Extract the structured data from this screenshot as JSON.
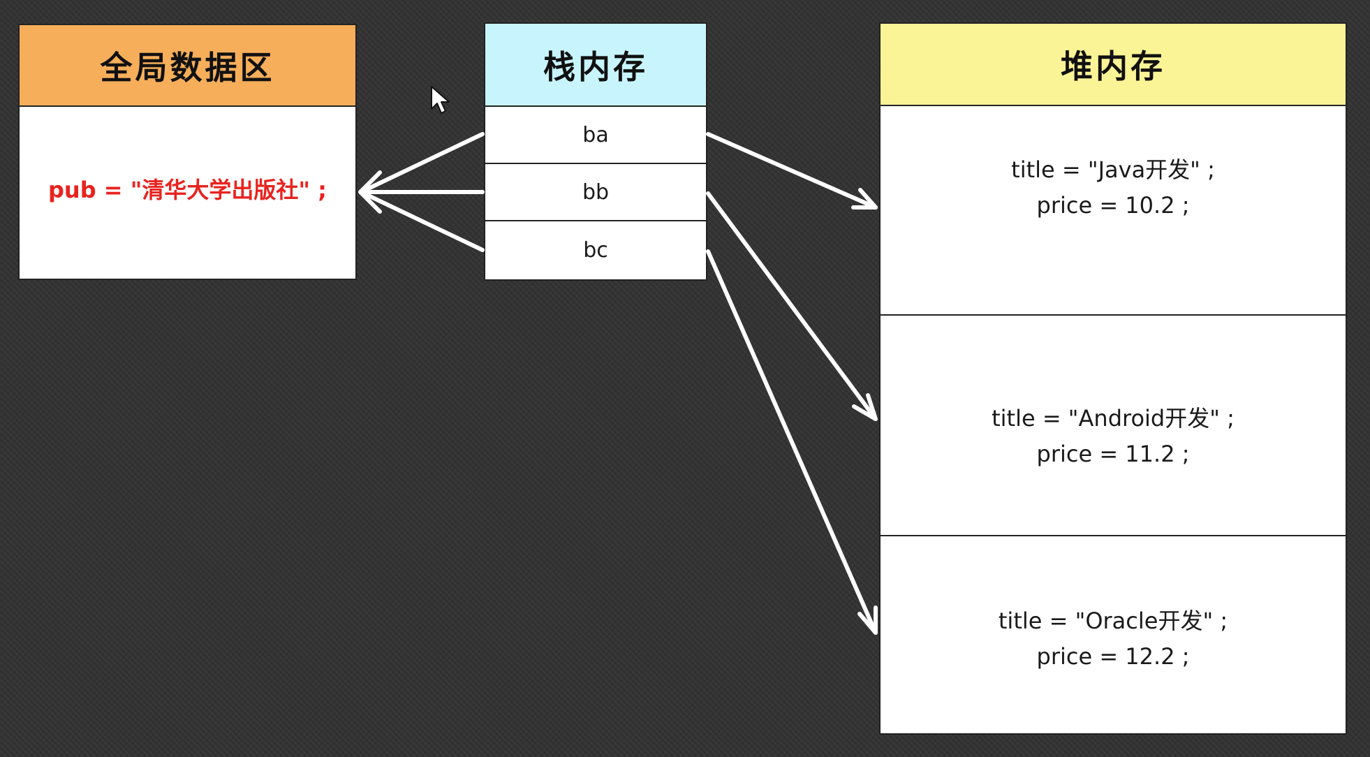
{
  "global_area": {
    "title": "全局数据区",
    "header_color": "#f6ae5b",
    "content": "pub = \"清华大学出版社\" ;",
    "content_color": "#e8231f"
  },
  "stack_memory": {
    "title": "栈内存",
    "header_color": "#c8f5fd",
    "cells": [
      "ba",
      "bb",
      "bc"
    ]
  },
  "heap_memory": {
    "title": "堆内存",
    "header_color": "#fbf497",
    "objects": [
      {
        "title_line": "title = \"Java开发\" ;",
        "price_line": "price = 10.2 ;"
      },
      {
        "title_line": "title = \"Android开发\" ;",
        "price_line": "price = 11.2 ;"
      },
      {
        "title_line": "title = \"Oracle开发\" ;",
        "price_line": "price = 12.2 ;"
      }
    ]
  }
}
